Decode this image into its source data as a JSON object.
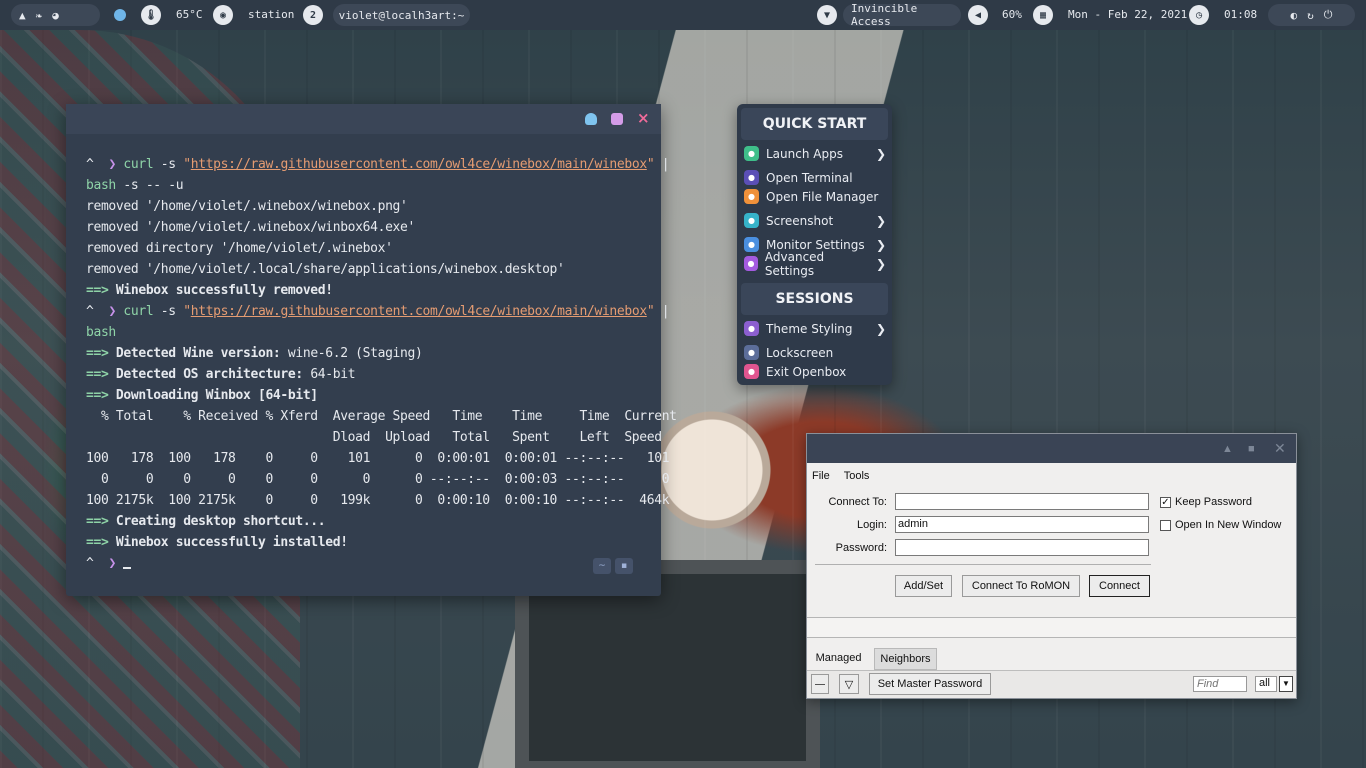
{
  "topbar": {
    "temperature": "65°C",
    "hostname": "station",
    "workspace": "2",
    "terminal_title": "violet@localh3art:~",
    "network": "Invincible Access",
    "volume": "60%",
    "date": "Mon - Feb 22, 2021",
    "time": "01:08"
  },
  "terminal": {
    "prompt_symbol": "^",
    "lines": [
      {
        "type": "cmd",
        "cmd": "curl",
        "args": " -s ",
        "quote_open": "\"",
        "url": "https://raw.githubusercontent.com/owl4ce/winebox/main/winebox",
        "quote_close": "\"",
        "pipe": " |"
      },
      {
        "type": "cont",
        "text": "bash",
        "rest": " -s -- -u"
      },
      {
        "type": "out",
        "text": "removed '/home/violet/.winebox/winebox.png'"
      },
      {
        "type": "out",
        "text": "removed '/home/violet/.winebox/winbox64.exe'"
      },
      {
        "type": "out",
        "text": "removed directory '/home/violet/.winebox'"
      },
      {
        "type": "out",
        "text": "removed '/home/violet/.local/share/applications/winebox.desktop'"
      },
      {
        "type": "arrow",
        "label": "Winebox successfully removed!",
        "value": ""
      },
      {
        "type": "cmd",
        "cmd": "curl",
        "args": " -s ",
        "quote_open": "\"",
        "url": "https://raw.githubusercontent.com/owl4ce/winebox/main/winebox",
        "quote_close": "\"",
        "pipe": " |"
      },
      {
        "type": "cont",
        "text": "bash",
        "rest": ""
      },
      {
        "type": "arrow",
        "label": "Detected Wine version:",
        "value": " wine-6.2 (Staging)"
      },
      {
        "type": "arrow",
        "label": "Detected OS architecture:",
        "value": " 64-bit"
      },
      {
        "type": "arrow",
        "label": "Downloading Winbox [64-bit]",
        "value": ""
      },
      {
        "type": "out",
        "text": "  % Total    % Received % Xferd  Average Speed   Time    Time     Time  Current"
      },
      {
        "type": "out",
        "text": "                                 Dload  Upload   Total   Spent    Left  Speed"
      },
      {
        "type": "out",
        "text": "100   178  100   178    0     0    101      0  0:00:01  0:00:01 --:--:--   101"
      },
      {
        "type": "out",
        "text": "  0     0    0     0    0     0      0      0 --:--:--  0:00:03 --:--:--     0"
      },
      {
        "type": "out",
        "text": "100 2175k  100 2175k    0     0   199k      0  0:00:10  0:00:10 --:--:--  464k"
      },
      {
        "type": "arrow",
        "label": "Creating desktop shortcut...",
        "value": ""
      },
      {
        "type": "arrow",
        "label": "Winebox successfully installed!",
        "value": ""
      },
      {
        "type": "prompt"
      }
    ],
    "arrow_text": "==>",
    "corner_buttons": [
      "~",
      "▪"
    ]
  },
  "menu": {
    "quick_start_title": "QUICK START",
    "sessions_title": "SESSIONS",
    "items": [
      {
        "label": "Launch Apps",
        "icon": "launch-apps-icon",
        "color": "#3fbf8a",
        "submenu": true
      },
      {
        "label": "Open Terminal",
        "icon": "terminal-icon",
        "color": "#5b4fb6",
        "submenu": false
      },
      {
        "label": "Open File Manager",
        "icon": "file-manager-icon",
        "color": "#f0913a",
        "submenu": false
      },
      {
        "label": "Screenshot",
        "icon": "screenshot-icon",
        "color": "#36b3c9",
        "submenu": true
      },
      {
        "label": "Monitor Settings",
        "icon": "monitor-icon",
        "color": "#4a8fe0",
        "submenu": true
      },
      {
        "label": "Advanced Settings",
        "icon": "gear-icon",
        "color": "#a45be0",
        "submenu": true
      }
    ],
    "session_items": [
      {
        "label": "Theme Styling",
        "icon": "palette-icon",
        "color": "#8c5fd0",
        "submenu": true
      },
      {
        "label": "Lockscreen",
        "icon": "lock-icon",
        "color": "#5c6e9a",
        "submenu": false
      },
      {
        "label": "Exit Openbox",
        "icon": "exit-icon",
        "color": "#e0558f",
        "submenu": false
      }
    ]
  },
  "winbox": {
    "menu_file": "File",
    "menu_tools": "Tools",
    "connect_to_label": "Connect To:",
    "connect_to_value": "",
    "login_label": "Login:",
    "login_value": "admin",
    "password_label": "Password:",
    "password_value": "",
    "keep_password": "Keep Password",
    "open_new_window": "Open In New Window",
    "add_set": "Add/Set",
    "connect_romon": "Connect To RoMON",
    "connect": "Connect",
    "tab_managed": "Managed",
    "tab_neighbors": "Neighbors",
    "set_master_password": "Set Master Password",
    "find_placeholder": "Find",
    "filter_value": "all"
  }
}
